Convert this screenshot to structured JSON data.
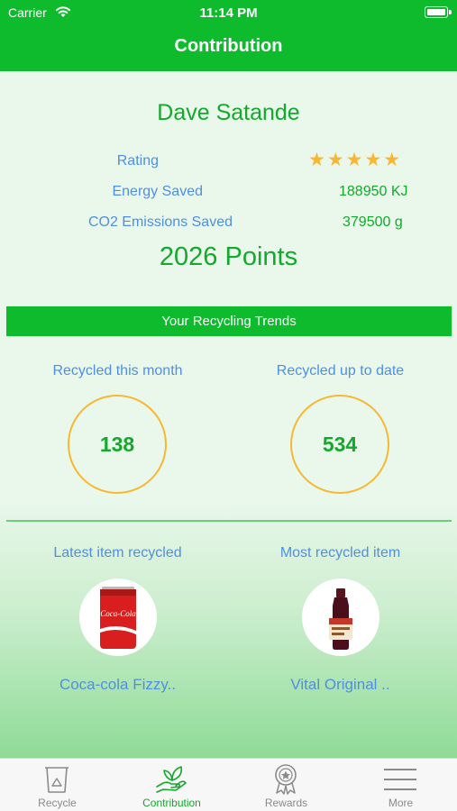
{
  "status_bar": {
    "carrier": "Carrier",
    "time": "11:14 PM"
  },
  "header": {
    "title": "Contribution"
  },
  "profile": {
    "name": "Dave Satande",
    "rating_label": "Rating",
    "rating_value": 5,
    "rating_max": 5,
    "stars_text": "★★★★★",
    "energy_label": "Energy Saved",
    "energy_value": "188950 KJ",
    "co2_label": "CO2 Emissions Saved",
    "co2_value": "379500 g",
    "points": "2026 Points"
  },
  "trends": {
    "title": "Your Recycling Trends",
    "month_label": "Recycled this month",
    "month_value": "138",
    "total_label": "Recycled up to date",
    "total_value": "534"
  },
  "items": {
    "latest_label": "Latest item recycled",
    "latest_name": "Coca-cola Fizzy..",
    "latest_can_text": "Coca-Cola",
    "most_label": "Most recycled item",
    "most_name": "Vital Original .."
  },
  "tabs": [
    {
      "label": "Recycle",
      "icon": "recycle-bin-icon",
      "active": false
    },
    {
      "label": "Contribution",
      "icon": "hand-leaf-icon",
      "active": true
    },
    {
      "label": "Rewards",
      "icon": "medal-icon",
      "active": false
    },
    {
      "label": "More",
      "icon": "menu-icon",
      "active": false
    }
  ],
  "colors": {
    "brand_green": "#0dbb2d",
    "text_green": "#14a82c",
    "text_blue": "#4f8fe0",
    "star_orange": "#f7b733"
  }
}
